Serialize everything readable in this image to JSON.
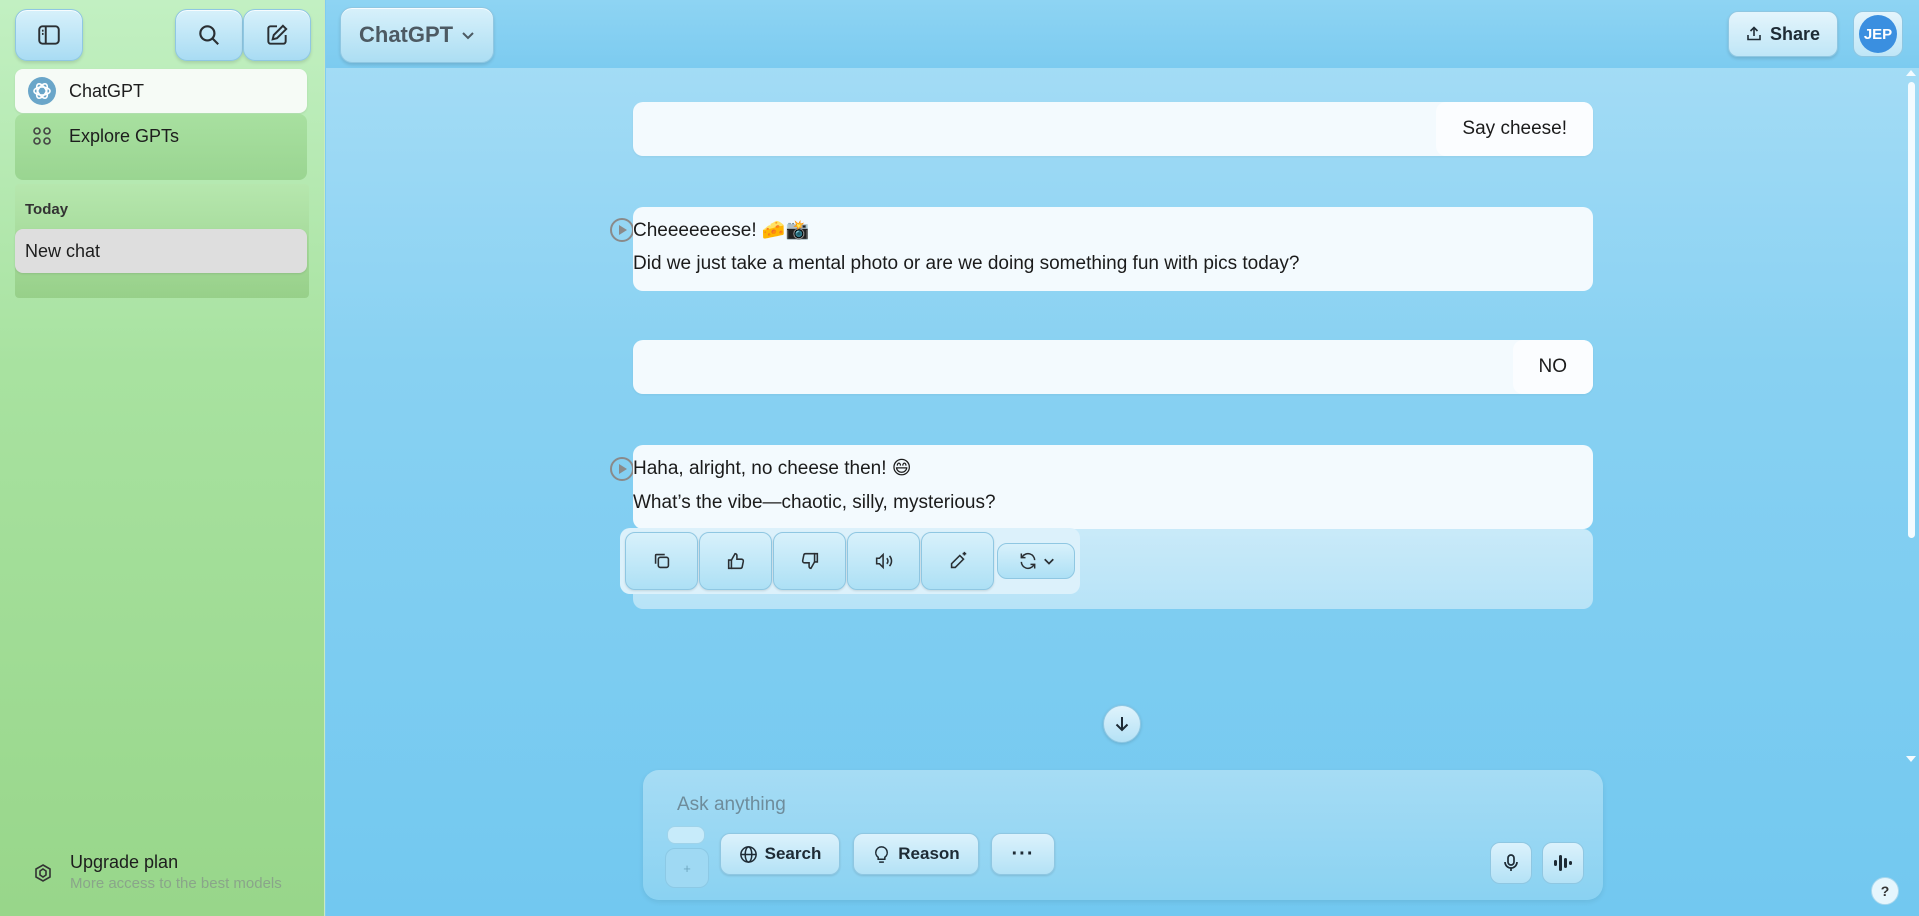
{
  "sidebar": {
    "nav": [
      {
        "label": "ChatGPT",
        "icon": "chatgpt-logo-icon"
      },
      {
        "label": "Explore GPTs",
        "icon": "grid-icon"
      }
    ],
    "section_label": "Today",
    "history": [
      {
        "label": "New chat"
      }
    ],
    "upgrade": {
      "title": "Upgrade plan",
      "subtitle": "More access to the best models"
    }
  },
  "header": {
    "model": "ChatGPT",
    "share_label": "Share",
    "avatar_initials": "JEP"
  },
  "conversation": [
    {
      "role": "user",
      "text": "Say cheese!"
    },
    {
      "role": "assistant",
      "lines": [
        "Cheeeeeeese! 🧀📸",
        "Did we just take a mental photo or are we doing something fun with pics today?"
      ]
    },
    {
      "role": "user",
      "text": "NO"
    },
    {
      "role": "assistant",
      "lines": [
        "Haha, alright, no cheese then! 😄",
        "What’s the vibe—chaotic, silly, mysterious?"
      ]
    }
  ],
  "composer": {
    "placeholder": "Ask anything",
    "plus_label": "+",
    "search_label": "Search",
    "reason_label": "Reason",
    "more_label": "···"
  },
  "help_label": "?",
  "colors": {
    "sidebar_bg": "#a8e2a0",
    "main_bg": "#88d1f2",
    "avatar_bg": "#3a8fe0"
  }
}
